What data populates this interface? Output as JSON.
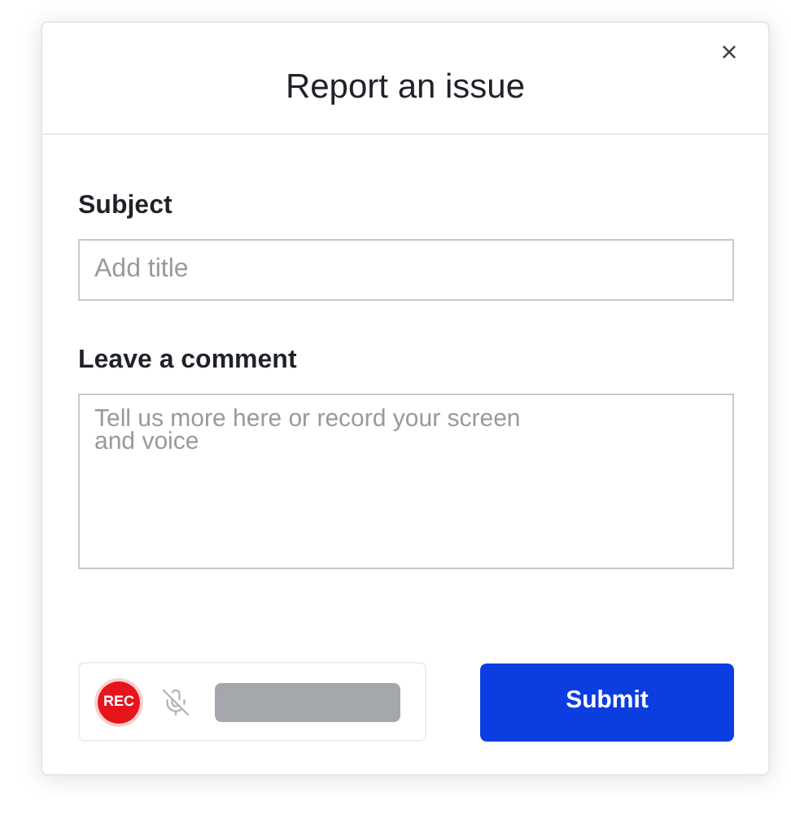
{
  "dialog": {
    "title": "Report an issue",
    "close": "×"
  },
  "subject": {
    "label": "Subject",
    "placeholder": "Add title"
  },
  "comment": {
    "label": "Leave a comment",
    "placeholder": "Tell us more here or record your screen\nand voice"
  },
  "recorder": {
    "rec_label": "REC",
    "muted": true
  },
  "submit": "Submit"
}
